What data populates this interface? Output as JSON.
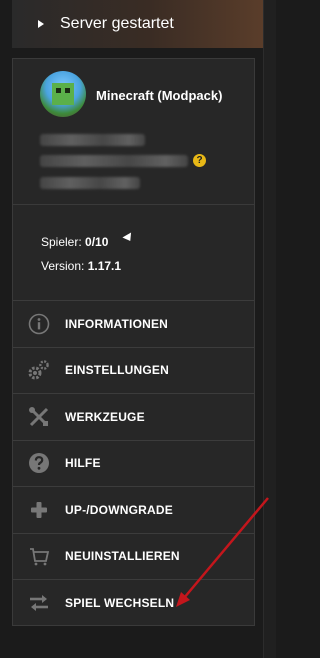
{
  "status": {
    "label": "Server gestartet",
    "icon": "play-icon"
  },
  "server": {
    "name": "Minecraft (Modpack)",
    "help_icon": "?"
  },
  "info": {
    "players_label": "Spieler:",
    "players_value": "0/10",
    "version_label": "Version:",
    "version_value": "1.17.1"
  },
  "menu": [
    {
      "label": "INFORMATIONEN",
      "icon": "info-icon"
    },
    {
      "label": "EINSTELLUNGEN",
      "icon": "gear-icon"
    },
    {
      "label": "WERKZEUGE",
      "icon": "tools-icon"
    },
    {
      "label": "HILFE",
      "icon": "question-icon"
    },
    {
      "label": "UP-/DOWNGRADE",
      "icon": "plus-icon"
    },
    {
      "label": "NEUINSTALLIEREN",
      "icon": "cart-icon"
    },
    {
      "label": "SPIEL WECHSELN",
      "icon": "swap-icon"
    }
  ],
  "colors": {
    "background": "#1b1b1b",
    "panel": "#272727",
    "badge": "#e8b816",
    "arrow": "#c4161c"
  }
}
